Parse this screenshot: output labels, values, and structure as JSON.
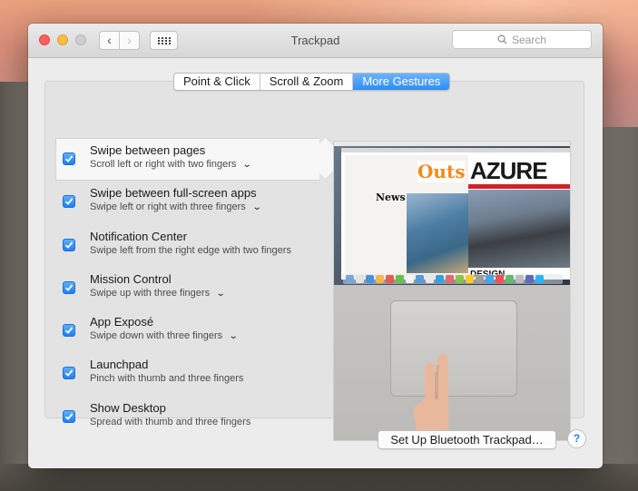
{
  "window": {
    "title": "Trackpad"
  },
  "toolbar": {
    "back_icon": "chevron-left-icon",
    "forward_icon": "chevron-right-icon",
    "grid_icon": "show-all-grid-icon",
    "search_placeholder": "Search",
    "search_icon": "search-icon"
  },
  "tabs": [
    {
      "label": "Point & Click",
      "active": false
    },
    {
      "label": "Scroll & Zoom",
      "active": false
    },
    {
      "label": "More Gestures",
      "active": true
    }
  ],
  "gestures": [
    {
      "title": "Swipe between pages",
      "subtitle": "Scroll left or right with two fingers",
      "checked": true,
      "has_menu": true,
      "selected": true
    },
    {
      "title": "Swipe between full-screen apps",
      "subtitle": "Swipe left or right with three fingers",
      "checked": true,
      "has_menu": true
    },
    {
      "title": "Notification Center",
      "subtitle": "Swipe left from the right edge with two fingers",
      "checked": true,
      "has_menu": false
    },
    {
      "title": "Mission Control",
      "subtitle": "Swipe up with three fingers",
      "checked": true,
      "has_menu": true
    },
    {
      "title": "App Exposé",
      "subtitle": "Swipe down with three fingers",
      "checked": true,
      "has_menu": true
    },
    {
      "title": "Launchpad",
      "subtitle": "Pinch with thumb and three fingers",
      "checked": true,
      "has_menu": false
    },
    {
      "title": "Show Desktop",
      "subtitle": "Spread with thumb and three fingers",
      "checked": true,
      "has_menu": false
    }
  ],
  "preview": {
    "mag_a_logo": "Outs",
    "mag_a_heading": "News",
    "mag_b_logo": "AZURE",
    "mag_b_heading": "DESIGN"
  },
  "footer": {
    "setup_label": "Set Up Bluetooth Trackpad…",
    "help_label": "?"
  },
  "colors": {
    "accent": "#2e8ef7",
    "close": "#fc605c",
    "minimize": "#fdbc40"
  }
}
